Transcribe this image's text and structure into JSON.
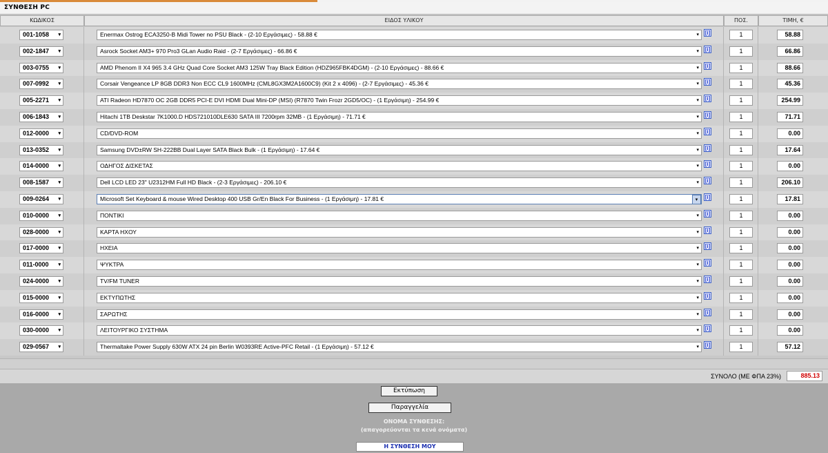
{
  "page": {
    "title": "ΣΥΝΘΕΣΗ PC"
  },
  "columns": {
    "code": "ΚΩΔΙΚΟΣ",
    "item": "ΕΙΔΟΣ ΥΛΙΚΟΥ",
    "qty": "ΠΟΣ.",
    "price": "ΤΙΜΗ, €"
  },
  "info_glyph": "[i]",
  "dropdown_glyph": "▾",
  "rows": [
    {
      "code": "001-1058",
      "item": "Enermax Ostrog ECA3250-B Midi Tower no PSU Black - (2-10 Εργάσιμες) - 58.88 €",
      "qty": "1",
      "price": "58.88"
    },
    {
      "code": "002-1847",
      "item": "Asrock Socket AM3+ 970 Pro3 GLan Audio Raid - (2-7 Εργάσιμες) - 66.86 €",
      "qty": "1",
      "price": "66.86"
    },
    {
      "code": "003-0755",
      "item": "AMD Phenom II X4 965 3.4 GHz Quad Core Socket AM3 125W Tray Black Edition (HDZ965FBK4DGM) - (2-10 Εργάσιμες) - 88.66 €",
      "qty": "1",
      "price": "88.66"
    },
    {
      "code": "007-0992",
      "item": "Corsair Vengeance LP 8GB DDR3 Non ECC CL9 1600MHz (CML8GX3M2A1600C9) (Kit 2 x 4096) - (2-7 Εργάσιμες) - 45.36 €",
      "qty": "1",
      "price": "45.36"
    },
    {
      "code": "005-2271",
      "item": "ATI Radeon HD7870 OC 2GB DDR5 PCI-E DVI HDMI Dual Mini-DP (MSI) (R7870 Twin Frozr 2GD5/OC) - (1 Εργάσιμη) - 254.99 €",
      "qty": "1",
      "price": "254.99"
    },
    {
      "code": "006-1843",
      "item": "Hitachi 1TB Deskstar 7K1000.D HDS721010DLE630 SATA III 7200rpm 32MB - (1 Εργάσιμη) - 71.71 €",
      "qty": "1",
      "price": "71.71"
    },
    {
      "code": "012-0000",
      "item": "CD/DVD-ROM",
      "qty": "1",
      "price": "0.00"
    },
    {
      "code": "013-0352",
      "item": "Samsung DVD±RW SH-222BB Dual Layer SATA Black Bulk - (1 Εργάσιμη) - 17.64 €",
      "qty": "1",
      "price": "17.64"
    },
    {
      "code": "014-0000",
      "item": "ΟΔΗΓΟΣ ΔΙΣΚΕΤΑΣ",
      "qty": "1",
      "price": "0.00"
    },
    {
      "code": "008-1587",
      "item": "Dell LCD LED 23\" U2312HM Full HD Black - (2-3 Εργάσιμες) - 206.10 €",
      "qty": "1",
      "price": "206.10"
    },
    {
      "code": "009-0264",
      "item": "Microsoft Set Keyboard & mouse Wired Desktop 400 USB Gr/En Black For Business - (1 Εργάσιμη) - 17.81 €",
      "qty": "1",
      "price": "17.81"
    },
    {
      "code": "010-0000",
      "item": "ΠΟΝΤΙΚΙ",
      "qty": "1",
      "price": "0.00"
    },
    {
      "code": "028-0000",
      "item": "ΚΑΡΤΑ ΗΧΟΥ",
      "qty": "1",
      "price": "0.00"
    },
    {
      "code": "017-0000",
      "item": "ΗΧΕΙΑ",
      "qty": "1",
      "price": "0.00"
    },
    {
      "code": "011-0000",
      "item": "ΨΥΚΤΡΑ",
      "qty": "1",
      "price": "0.00"
    },
    {
      "code": "024-0000",
      "item": "TV/FM TUNER",
      "qty": "1",
      "price": "0.00"
    },
    {
      "code": "015-0000",
      "item": "ΕΚΤΥΠΩΤΗΣ",
      "qty": "1",
      "price": "0.00"
    },
    {
      "code": "016-0000",
      "item": "ΣΑΡΩΤΗΣ",
      "qty": "1",
      "price": "0.00"
    },
    {
      "code": "030-0000",
      "item": "ΛΕΙΤΟΥΡΓΙΚΟ ΣΥΣΤΗΜΑ",
      "qty": "1",
      "price": "0.00"
    },
    {
      "code": "029-0567",
      "item": "Thermaltake Power Supply 630W ATX 24 pin Berlin W0393RE Active-PFC Retail - (1 Εργάσιμη) - 57.12 €",
      "qty": "1",
      "price": "57.12"
    }
  ],
  "total": {
    "label": "ΣΥΝΟΛΟ (ΜΕ ΦΠΑ 23%)",
    "value": "885.13"
  },
  "buttons": {
    "print": "Εκτύπωση",
    "order": "Παραγγελία"
  },
  "name_section": {
    "label": "ΟΝΟΜΑ ΣΥΝΘΕΣΗΣ:",
    "hint": "(απαγορεύονται τα κενά ονόματα)",
    "value": "Η ΣΥΝΘΕΣΗ ΜΟΥ"
  },
  "colors": {
    "total_value": "#d00000",
    "info_icon": "#2a46c8",
    "accent_stripe": "#d98a3a"
  }
}
